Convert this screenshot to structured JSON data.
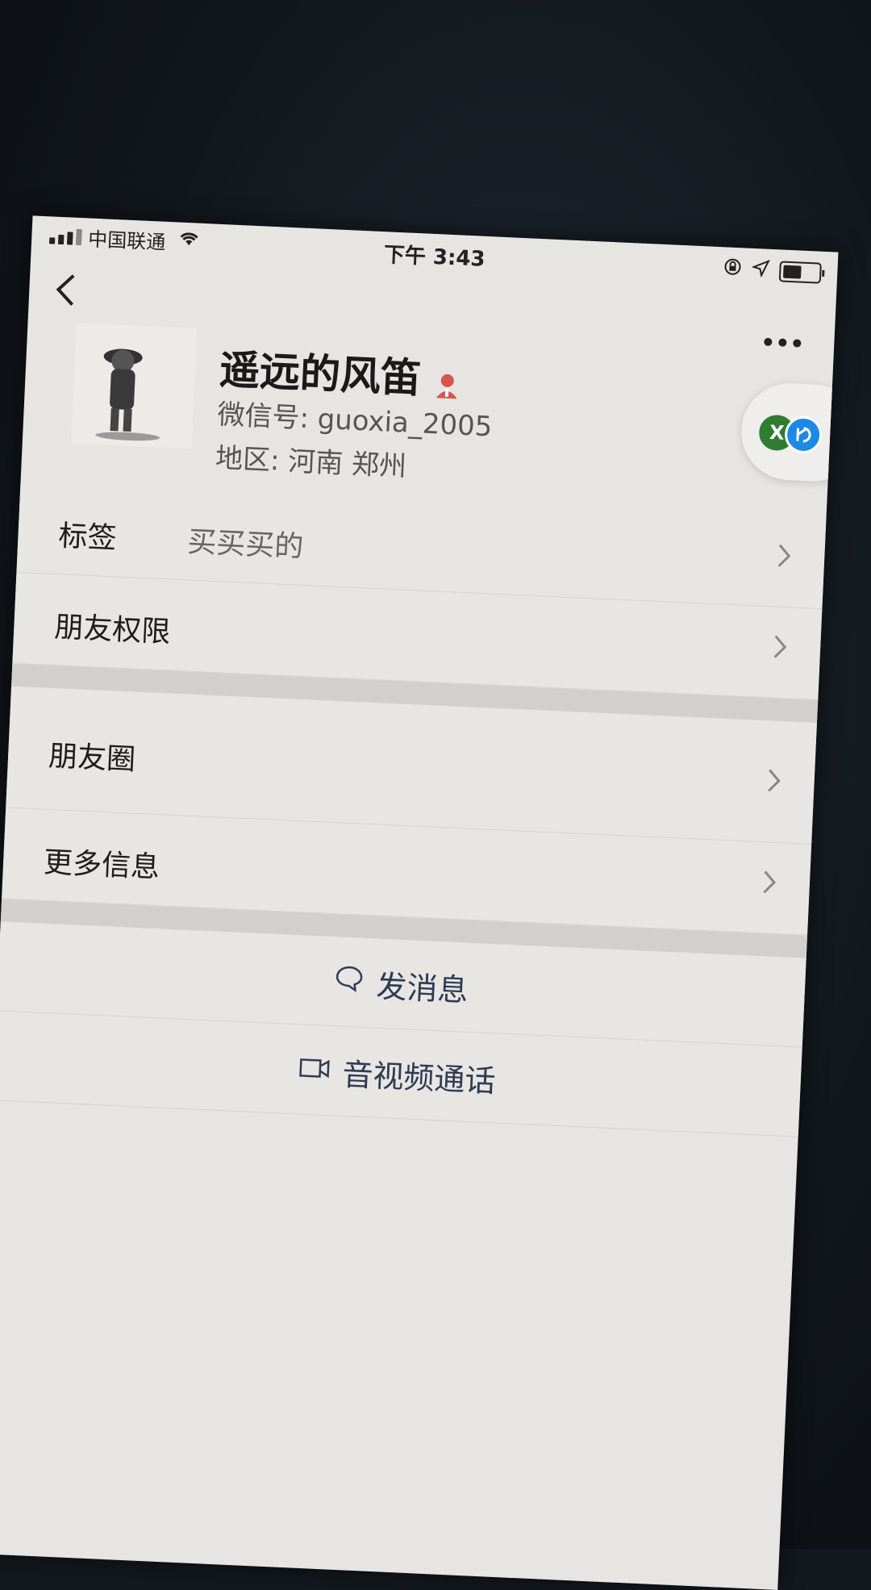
{
  "status_bar": {
    "carrier": "中国联通",
    "time": "下午 3:43"
  },
  "header": {
    "back_icon": "chevron-left-icon",
    "more_icon": "ellipsis-icon"
  },
  "profile": {
    "name": "遥远的风笛",
    "wechat_id": "微信号: guoxia_2005",
    "region": "地区: 河南 郑州",
    "gender_icon": "person-icon",
    "gender_color": "#d9534f"
  },
  "floating_button": {
    "left_letter": "X"
  },
  "rows": [
    {
      "label": "标签",
      "value": "买买买的"
    },
    {
      "label": "朋友权限",
      "value": ""
    },
    {
      "label": "朋友圈",
      "value": ""
    },
    {
      "label": "更多信息",
      "value": ""
    }
  ],
  "actions": {
    "message": "发消息",
    "call": "音视频通话"
  },
  "colors": {
    "action_text": "#2f3a55",
    "background": "#e8e6e2"
  }
}
